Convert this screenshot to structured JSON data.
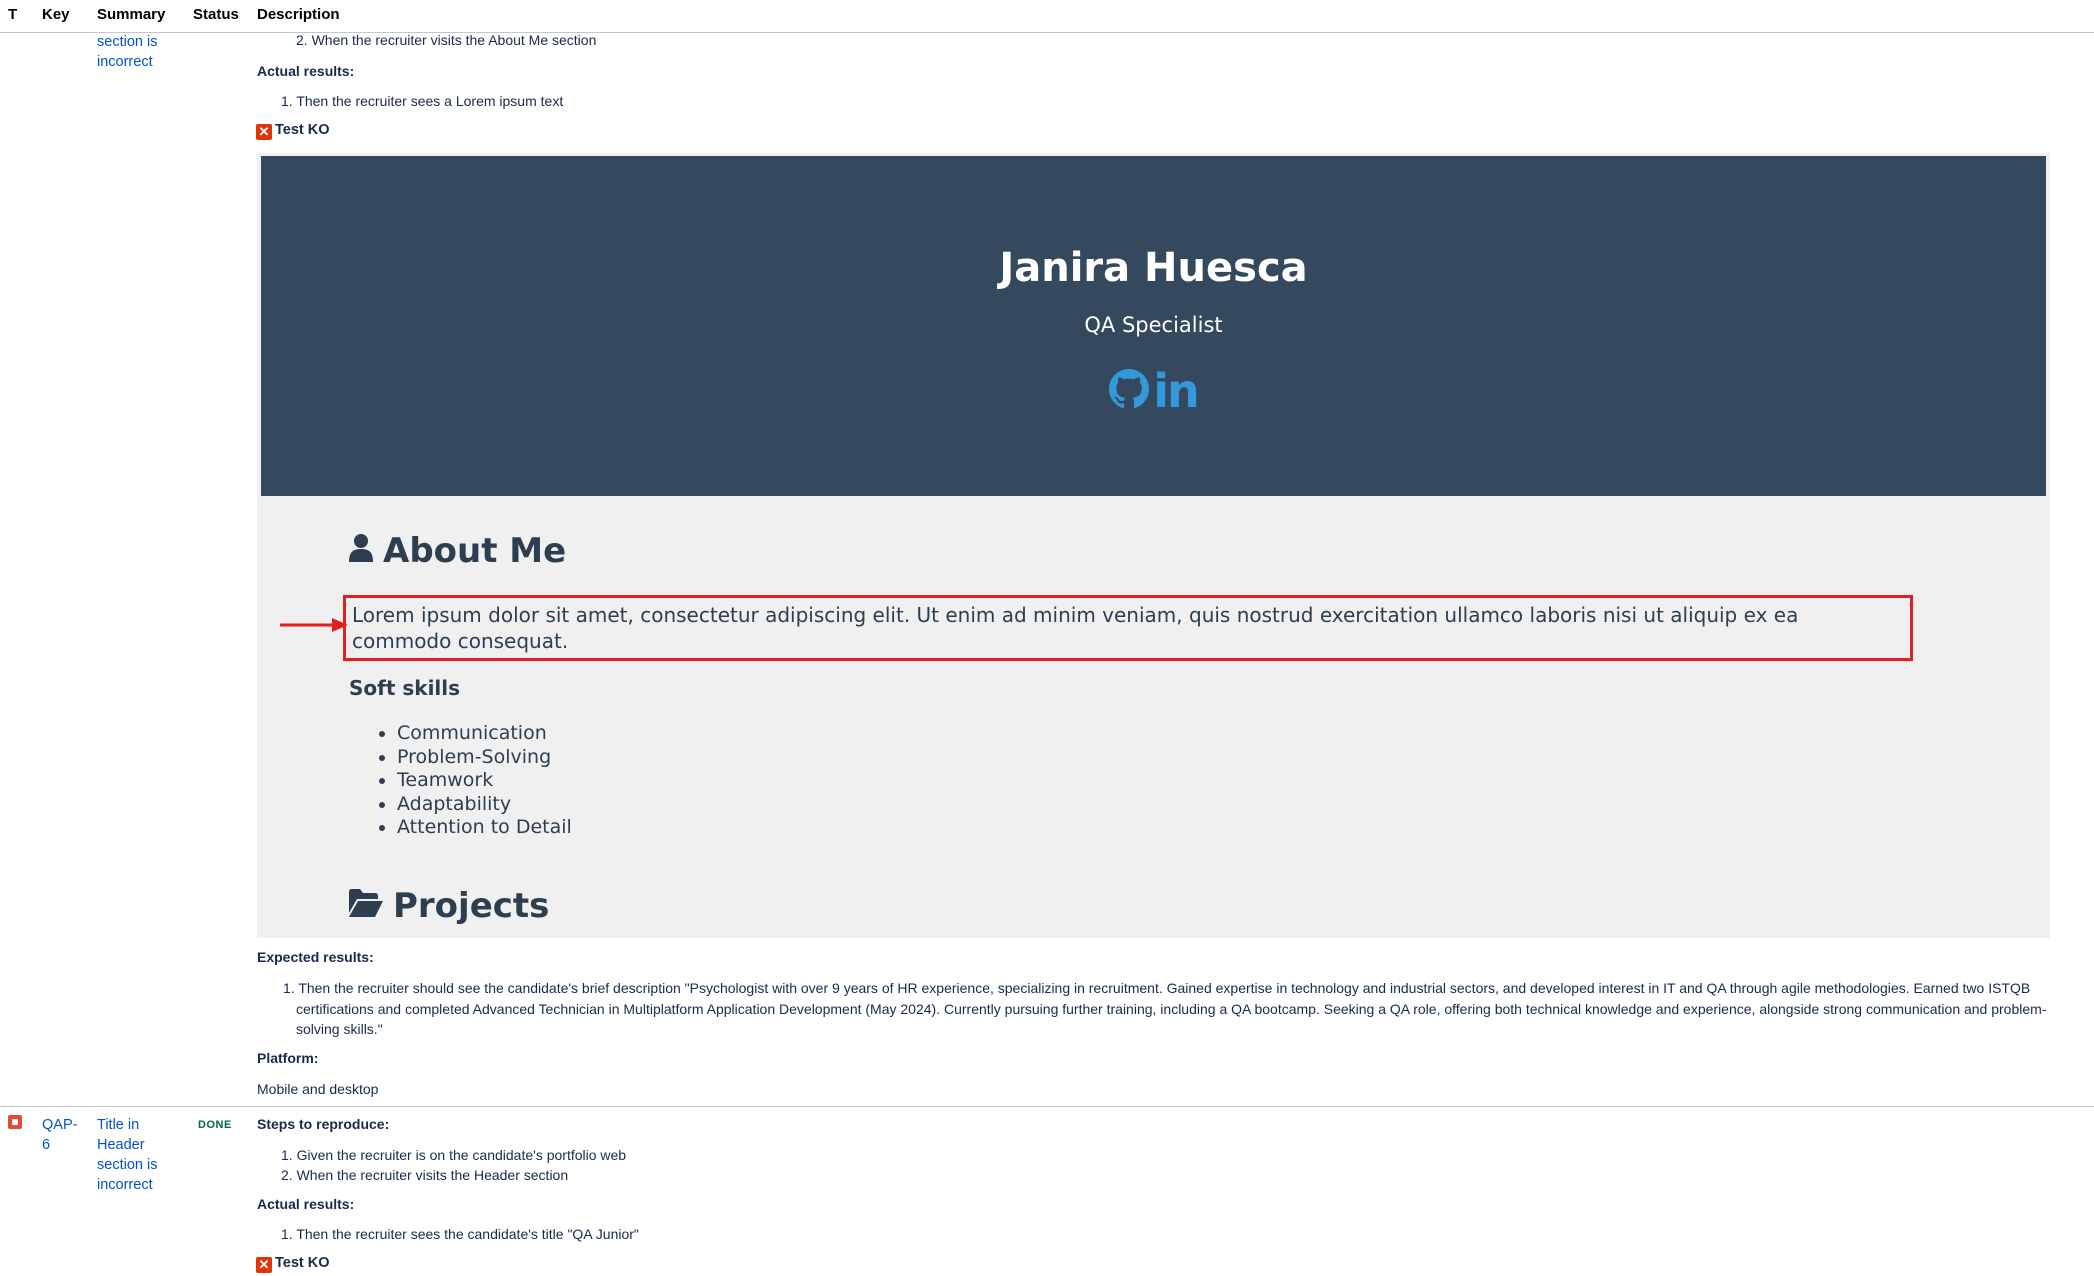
{
  "columns": {
    "t": "T",
    "key": "Key",
    "summary": "Summary",
    "status": "Status",
    "description": "Description"
  },
  "issue1": {
    "summary_lines": [
      "section is",
      "incorrect"
    ],
    "step2": "2. When the recruiter visits the About Me section",
    "actual_label": "Actual results:",
    "actual1": "1. Then the recruiter sees a Lorem ipsum text",
    "test_result": "Test KO",
    "expected_label": "Expected results:",
    "expected1": "1. Then the recruiter should see the candidate's brief description \"Psychologist with over 9 years of HR experience, specializing in recruitment. Gained expertise in technology and industrial sectors, and developed interest in IT and QA through agile methodologies. Earned two ISTQB certifications and completed Advanced Technician in Multiplatform Application Development (May 2024). Currently pursuing further training, including a QA bootcamp. Seeking a QA role, offering both technical knowledge and experience, alongside strong communication and problem-solving skills.\"",
    "platform_label": "Platform:",
    "platform": "Mobile and desktop"
  },
  "portfolio": {
    "name": "Janira Huesca",
    "title": "QA Specialist",
    "social_icons": [
      "github-icon",
      "linkedin-icon"
    ],
    "linkedin_glyph": "in",
    "about_heading": "About Me",
    "about_text": "Lorem ipsum dolor sit amet, consectetur adipiscing elit. Ut enim ad minim veniam, quis nostrud exercitation ullamco laboris nisi ut aliquip ex ea commodo consequat.",
    "soft_skills_heading": "Soft skills",
    "soft_skills": [
      "Communication",
      "Problem-Solving",
      "Teamwork",
      "Adaptability",
      "Attention to Detail"
    ],
    "projects_heading": "Projects",
    "colors": {
      "hero_bg": "#34495e",
      "accent": "#3498db",
      "text": "#2c3e50",
      "highlight": "#e02020"
    }
  },
  "issue2": {
    "key_lines": [
      "QAP-",
      "6"
    ],
    "summary_lines": [
      "Title in",
      "Header",
      "section is",
      "incorrect"
    ],
    "status": "DONE",
    "steps_label": "Steps to reproduce:",
    "step1": "1. Given the recruiter is on the candidate's portfolio web",
    "step2": "2. When the recruiter visits the Header section",
    "actual_label": "Actual results:",
    "actual1": "1. Then the recruiter sees the candidate's title \"QA Junior\"",
    "test_result": "Test KO"
  }
}
